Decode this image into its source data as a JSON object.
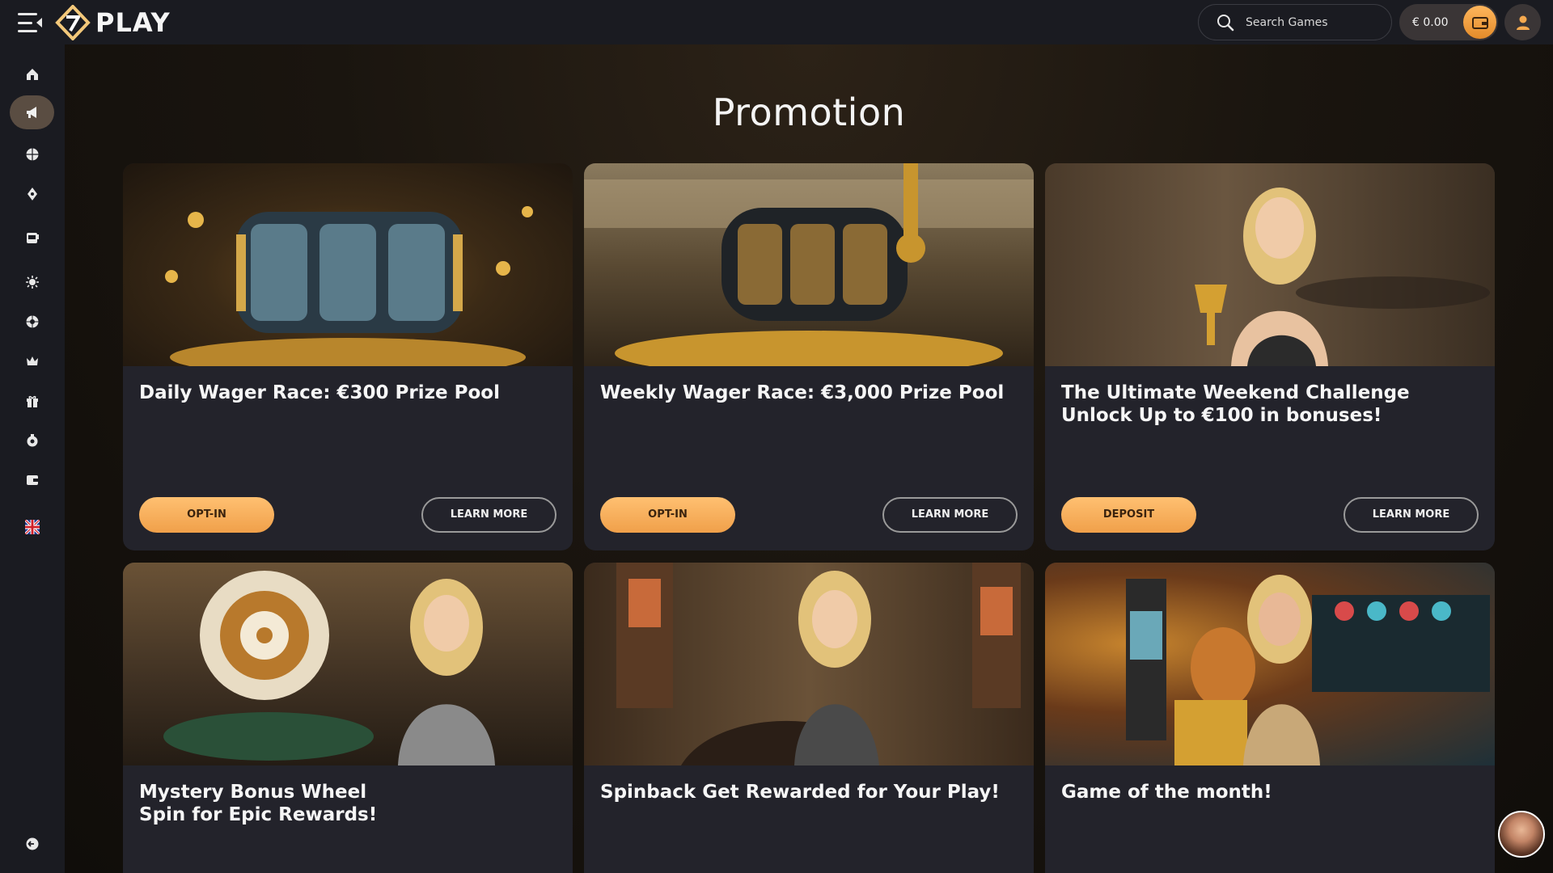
{
  "header": {
    "brand": "PLAY",
    "search_placeholder": "Search Games",
    "balance": "€ 0.00"
  },
  "sidebar": {
    "items": [
      {
        "name": "home",
        "active": false
      },
      {
        "name": "promotions",
        "active": true
      },
      {
        "name": "sports",
        "active": false
      },
      {
        "name": "casino",
        "active": false
      },
      {
        "name": "live-casino",
        "active": false
      },
      {
        "name": "new",
        "active": false
      },
      {
        "name": "roulette",
        "active": false
      },
      {
        "name": "vip",
        "active": false
      },
      {
        "name": "gift",
        "active": false
      },
      {
        "name": "support",
        "active": false
      },
      {
        "name": "wallet",
        "active": false
      },
      {
        "name": "language-uk",
        "active": false
      },
      {
        "name": "logout",
        "active": false
      }
    ]
  },
  "main": {
    "title": "Promotion",
    "cards": [
      {
        "title": "Daily Wager Race: €300 Prize Pool",
        "primary": "OPT-IN",
        "secondary": "LEARN MORE"
      },
      {
        "title": "Weekly Wager Race: €3,000 Prize Pool",
        "primary": "OPT-IN",
        "secondary": "LEARN MORE"
      },
      {
        "title": "The Ultimate Weekend Challenge Unlock Up to €100 in bonuses!",
        "primary": "DEPOSIT",
        "secondary": "LEARN MORE"
      },
      {
        "title": "Mystery Bonus Wheel\nSpin for Epic Rewards!"
      },
      {
        "title": "Spinback Get Rewarded for Your Play!"
      },
      {
        "title": "Game of the month!"
      }
    ]
  },
  "colors": {
    "accent": "#f5a94f",
    "sidebar_bg": "#1a1b21",
    "card_bg": "#23232b",
    "active_item": "#5a4d42"
  }
}
